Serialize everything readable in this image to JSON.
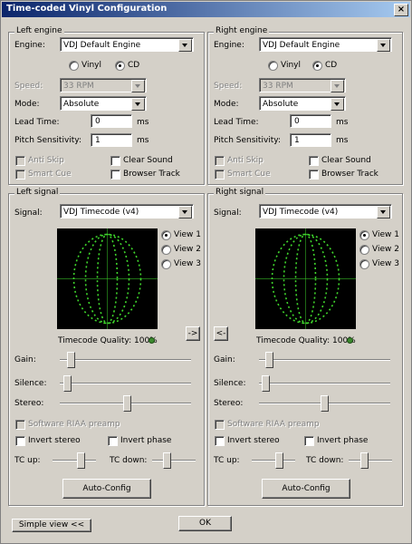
{
  "window": {
    "title": "Time-coded Vinyl Configuration",
    "close_glyph": "×"
  },
  "left_engine": {
    "legend": "Left engine",
    "engine_label": "Engine:",
    "engine_value": "VDJ Default Engine",
    "vinyl_label": "Vinyl",
    "cd_label": "CD",
    "selected": "CD",
    "speed_label": "Speed:",
    "speed_value": "33 RPM",
    "mode_label": "Mode:",
    "mode_value": "Absolute",
    "lead_label": "Lead Time:",
    "lead_value": "0",
    "lead_unit": "ms",
    "pitch_label": "Pitch Sensitivity:",
    "pitch_value": "1",
    "pitch_unit": "ms",
    "anti_skip": "Anti Skip",
    "clear_sound": "Clear Sound",
    "smart_cue": "Smart Cue",
    "browser_track": "Browser Track"
  },
  "right_engine": {
    "legend": "Right engine",
    "engine_label": "Engine:",
    "engine_value": "VDJ Default Engine",
    "vinyl_label": "Vinyl",
    "cd_label": "CD",
    "selected": "CD",
    "speed_label": "Speed:",
    "speed_value": "33 RPM",
    "mode_label": "Mode:",
    "mode_value": "Absolute",
    "lead_label": "Lead Time:",
    "lead_value": "0",
    "lead_unit": "ms",
    "pitch_label": "Pitch Sensitivity:",
    "pitch_value": "1",
    "pitch_unit": "ms",
    "anti_skip": "Anti Skip",
    "clear_sound": "Clear Sound",
    "smart_cue": "Smart Cue",
    "browser_track": "Browser Track"
  },
  "left_signal": {
    "legend": "Left signal",
    "signal_label": "Signal:",
    "signal_value": "VDJ Timecode (v4)",
    "views": [
      "View 1",
      "View 2",
      "View 3"
    ],
    "selected_view": "View 1",
    "quality_text": "Timecode Quality: 100%",
    "copy_button": "->",
    "gain_label": "Gain:",
    "gain_level": 0.05,
    "silence_label": "Silence:",
    "silence_level": 0.02,
    "stereo_label": "Stereo:",
    "stereo_level": 0.5,
    "riaa_label": "Software RIAA preamp",
    "invert_stereo": "Invert stereo",
    "invert_phase": "Invert phase",
    "tc_up_label": "TC up:",
    "tc_up_level": 0.5,
    "tc_down_label": "TC down:",
    "tc_down_level": 0.5,
    "autoconfig": "Auto-Config"
  },
  "right_signal": {
    "legend": "Right signal",
    "signal_label": "Signal:",
    "signal_value": "VDJ Timecode (v4)",
    "views": [
      "View 1",
      "View 2",
      "View 3"
    ],
    "selected_view": "View 1",
    "quality_text": "Timecode Quality: 100%",
    "copy_button": "<-",
    "gain_label": "Gain:",
    "gain_level": 0.05,
    "silence_label": "Silence:",
    "silence_level": 0.02,
    "stereo_label": "Stereo:",
    "stereo_level": 0.5,
    "riaa_label": "Software RIAA preamp",
    "invert_stereo": "Invert stereo",
    "invert_phase": "Invert phase",
    "tc_up_label": "TC up:",
    "tc_up_level": 0.5,
    "tc_down_label": "TC down:",
    "tc_down_level": 0.5,
    "autoconfig": "Auto-Config"
  },
  "footer": {
    "simple_view": "Simple view <<",
    "ok": "OK"
  },
  "colors": {
    "title_start": "#0a246a",
    "title_end": "#a6caf0",
    "scope_bg": "#000000",
    "scope_trace": "#3fd62c",
    "led": "#3c8a2e"
  }
}
